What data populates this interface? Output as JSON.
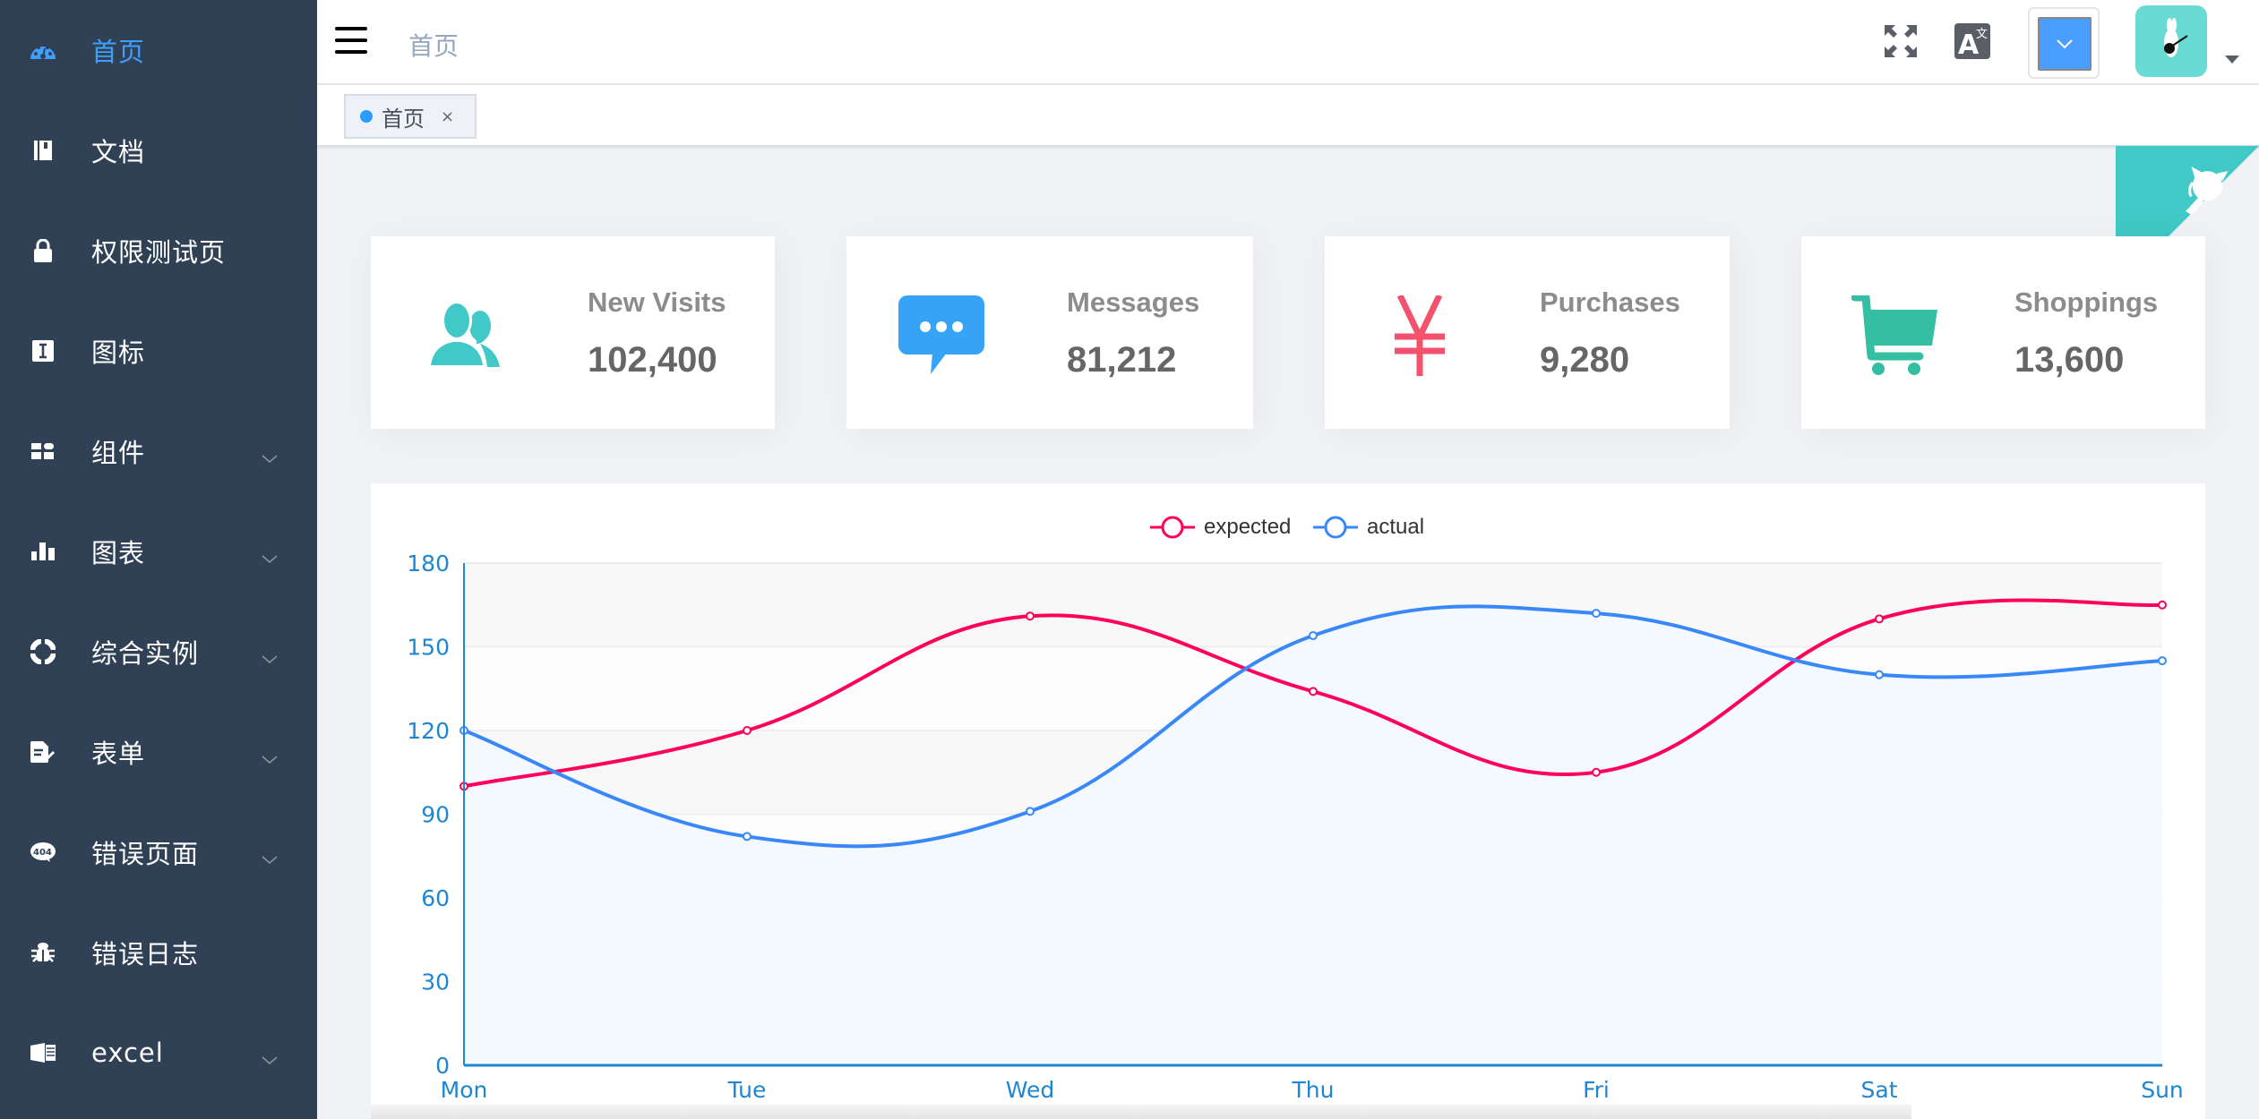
{
  "sidebar": {
    "items": [
      {
        "label": "首页",
        "icon": "dashboard-icon",
        "active": true,
        "has_children": false
      },
      {
        "label": "文档",
        "icon": "documentation-icon",
        "active": false,
        "has_children": false
      },
      {
        "label": "权限测试页",
        "icon": "lock-icon",
        "active": false,
        "has_children": false
      },
      {
        "label": "图标",
        "icon": "icon-icon",
        "active": false,
        "has_children": false
      },
      {
        "label": "组件",
        "icon": "component-icon",
        "active": false,
        "has_children": true
      },
      {
        "label": "图表",
        "icon": "chart-icon",
        "active": false,
        "has_children": true
      },
      {
        "label": "综合实例",
        "icon": "example-icon",
        "active": false,
        "has_children": true
      },
      {
        "label": "表单",
        "icon": "form-icon",
        "active": false,
        "has_children": true
      },
      {
        "label": "错误页面",
        "icon": "404-icon",
        "active": false,
        "has_children": true
      },
      {
        "label": "错误日志",
        "icon": "bug-icon",
        "active": false,
        "has_children": false
      },
      {
        "label": "excel",
        "icon": "excel-icon",
        "active": false,
        "has_children": true
      }
    ],
    "colors": {
      "background": "#304156",
      "active": "#409EFF",
      "text": "#ffffff"
    }
  },
  "header": {
    "breadcrumb": "首页",
    "icons": [
      "hamburger-icon",
      "fullscreen-icon",
      "language-icon",
      "size-select-icon",
      "avatar",
      "caret-down-icon"
    ]
  },
  "tags_view": {
    "tags": [
      {
        "label": "首页",
        "close": "×",
        "active": true
      }
    ]
  },
  "panels": [
    {
      "title": "New Visits",
      "value": "102,400",
      "icon": "peoples-icon",
      "color": "#40c9c6"
    },
    {
      "title": "Messages",
      "value": "81,212",
      "icon": "message-icon",
      "color": "#36a3f7"
    },
    {
      "title": "Purchases",
      "value": "9,280",
      "icon": "money-icon",
      "color": "#f4516c"
    },
    {
      "title": "Shoppings",
      "value": "13,600",
      "icon": "shopping-icon",
      "color": "#34bfa3"
    }
  ],
  "chart_data": {
    "type": "line",
    "title": "",
    "categories": [
      "Mon",
      "Tue",
      "Wed",
      "Thu",
      "Fri",
      "Sat",
      "Sun"
    ],
    "series": [
      {
        "name": "expected",
        "color": "#FF005A",
        "values": [
          100,
          120,
          161,
          134,
          105,
          160,
          165
        ]
      },
      {
        "name": "actual",
        "color": "#3888fa",
        "values": [
          120,
          82,
          91,
          154,
          162,
          140,
          145
        ],
        "area": true
      }
    ],
    "y_ticks": [
      "0",
      "30",
      "60",
      "90",
      "120",
      "150",
      "180"
    ],
    "ylim": [
      0,
      180
    ],
    "grid": true,
    "legend_position": "top-center",
    "smooth": true
  }
}
